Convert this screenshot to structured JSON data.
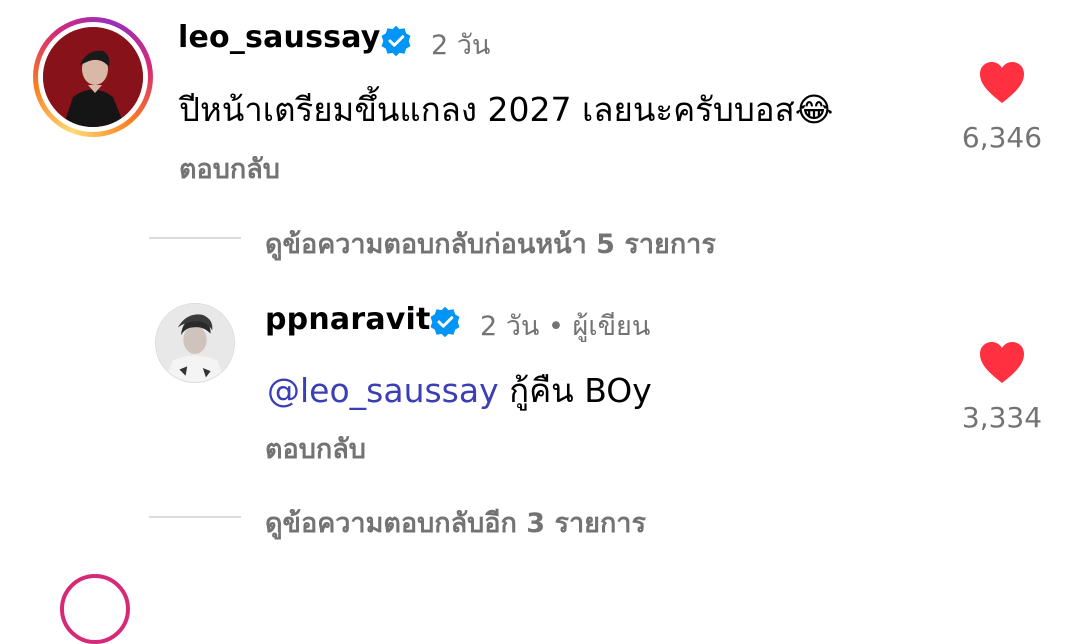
{
  "colors": {
    "mention": "#3b3fb5",
    "heart": "#ff3040",
    "verified": "#0095f6",
    "secondary_text": "#737373"
  },
  "comments": [
    {
      "username": "leo_saussay",
      "verified": true,
      "time": "2 วัน",
      "text": "ปีหน้าเตรียมขึ้นแกลง 2027 เลยนะครับบอส",
      "emoji": "😂",
      "reply_label": "ตอบกลับ",
      "likes": "6,346",
      "liked": true,
      "view_previous_replies": "ดูข้อความตอบกลับก่อนหน้า 5 รายการ"
    }
  ],
  "reply": {
    "username": "ppnaravit",
    "verified": true,
    "time": "2 วัน",
    "separator": "•",
    "author_label": "ผู้เขียน",
    "mention": "@leo_saussay",
    "text": " กู้คืน BOy",
    "reply_label": "ตอบกลับ",
    "likes": "3,334",
    "liked": true,
    "view_more_replies": "ดูข้อความตอบกลับอีก 3 รายการ"
  }
}
